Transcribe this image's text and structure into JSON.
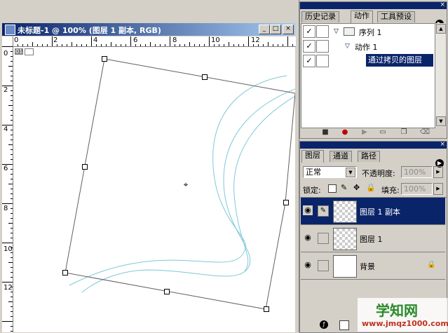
{
  "document": {
    "title": "未标题-1 @ 100% (图层 1 副本, RGB)",
    "zoom_badge": "01",
    "ruler_h_labels": [
      "0",
      "2",
      "4",
      "6",
      "8",
      "10",
      "12"
    ],
    "ruler_v_labels": [
      "0",
      "2",
      "4",
      "6",
      "8",
      "10",
      "12"
    ]
  },
  "actions_panel": {
    "tabs": [
      "历史记录",
      "动作",
      "工具预设"
    ],
    "active_tab": "动作",
    "items": [
      {
        "label": "序列 1"
      },
      {
        "label": "动作 1"
      },
      {
        "label": "通过拷贝的图层"
      }
    ],
    "toolbar_icons": [
      "stop-icon",
      "record-icon",
      "play-icon",
      "folder-icon",
      "new-action-icon",
      "delete-icon"
    ]
  },
  "layers_panel": {
    "tabs": [
      "图层",
      "通道",
      "路径"
    ],
    "active_tab": "图层",
    "blend_mode": "正常",
    "opacity_label": "不透明度:",
    "opacity_value": "100%",
    "lock_label": "锁定:",
    "fill_label": "填充:",
    "fill_value": "100%",
    "layers": [
      {
        "name": "图层 1 副本",
        "selected": true
      },
      {
        "name": "图层 1",
        "selected": false
      },
      {
        "name": "背景",
        "selected": false
      }
    ]
  },
  "watermark": {
    "title": "学知网",
    "url": "www.jmqz1000.com"
  },
  "colors": {
    "selection": "#0a246a",
    "titlebar": "#0a246a",
    "curve": "#7ec8d8",
    "watermark": "#2a8a2a"
  }
}
